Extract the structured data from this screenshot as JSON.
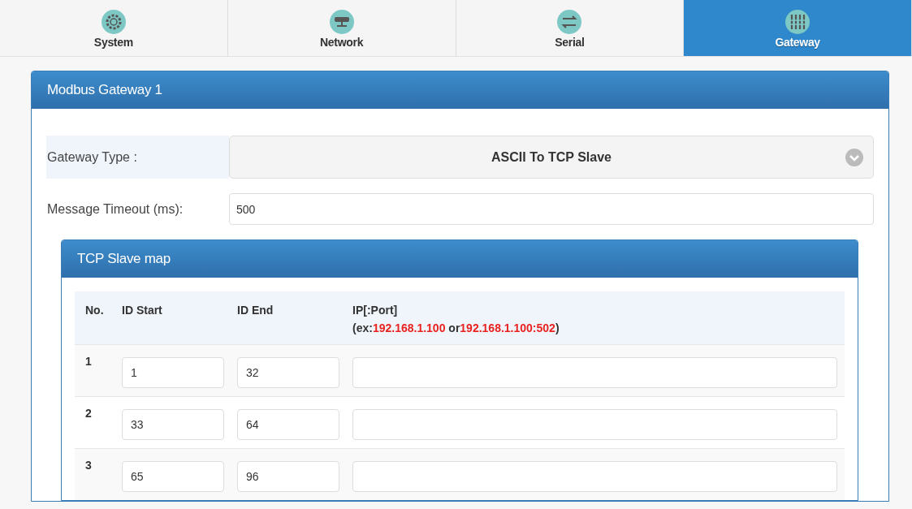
{
  "tabs": [
    {
      "label": "System",
      "kind": "gear",
      "selected": false
    },
    {
      "label": "Network",
      "kind": "network",
      "selected": false
    },
    {
      "label": "Serial",
      "kind": "arrows",
      "selected": false
    },
    {
      "label": "Gateway",
      "kind": "gateway",
      "selected": true
    }
  ],
  "panel": {
    "title": "Modbus Gateway 1",
    "gateway_type": {
      "label": "Gateway Type :",
      "value": "ASCII To TCP Slave"
    },
    "message_timeout": {
      "label": "Message Timeout (ms):",
      "value": "500"
    },
    "slave_map": {
      "title": "TCP Slave map",
      "columns": [
        "No.",
        "ID Start",
        "ID End",
        "IP[:Port]"
      ],
      "ip_hint": [
        {
          "text": "(ex:",
          "kind": "plain"
        },
        {
          "text": "192.168.1.100",
          "kind": "example"
        },
        {
          "text": " or",
          "kind": "plain"
        },
        {
          "text": "192.168.1.100:502",
          "kind": "example"
        },
        {
          "text": ")",
          "kind": "plain"
        }
      ],
      "rows": [
        {
          "no": "1",
          "id_start": "1",
          "id_end": "32"
        },
        {
          "no": "2",
          "id_start": "33",
          "id_end": "64"
        },
        {
          "no": "3",
          "id_start": "65",
          "id_end": "96"
        }
      ]
    }
  }
}
